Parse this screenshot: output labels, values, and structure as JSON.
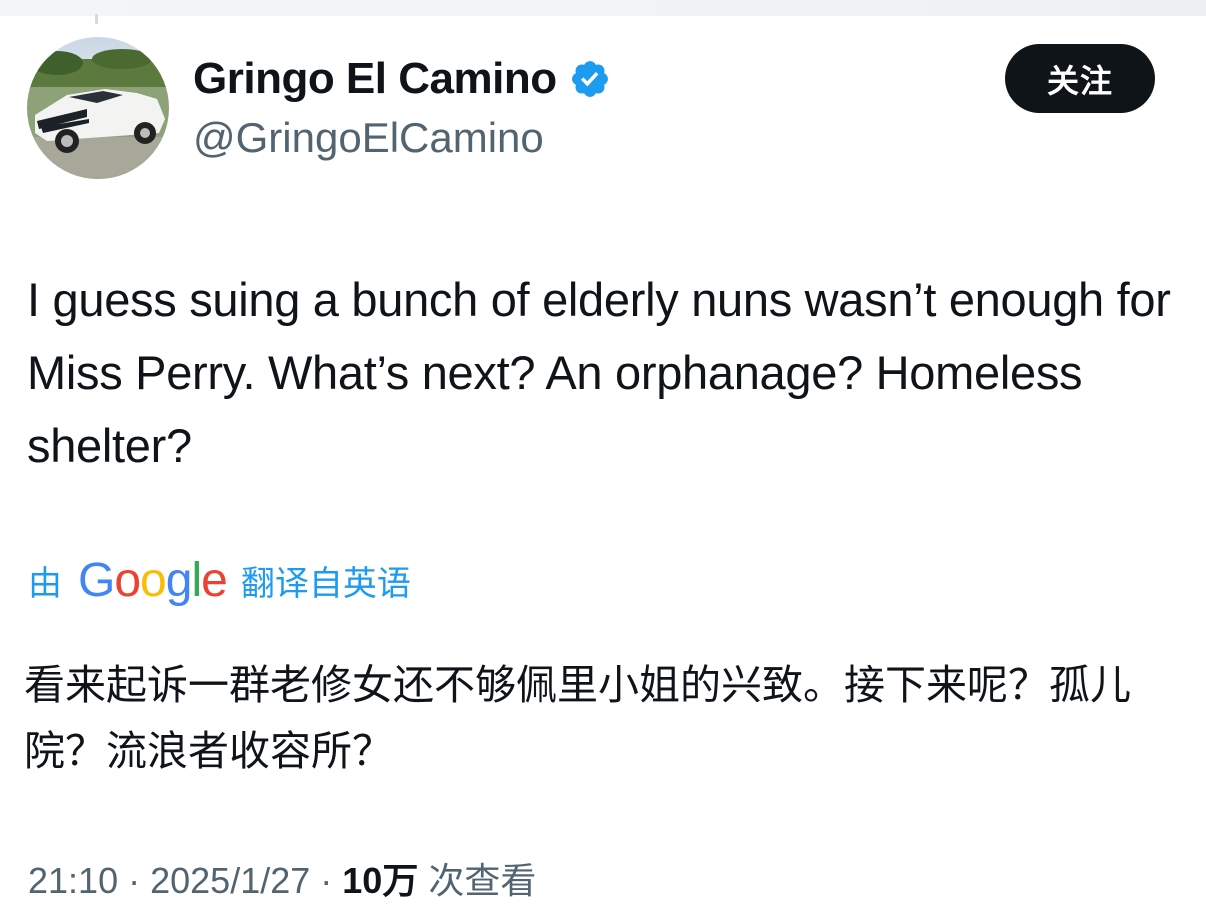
{
  "author": {
    "display_name": "Gringo El Camino",
    "handle": "@GringoElCamino",
    "verified_icon": "verified-badge-icon"
  },
  "follow_button": {
    "label": "关注"
  },
  "tweet": {
    "text": "I guess suing a bunch of elderly nuns wasn’t enough for Miss Perry. What’s next? An orphanage? Homeless shelter?"
  },
  "translation": {
    "by_label": "由",
    "google_logo_text": "Google",
    "from_label": "翻译自英语",
    "text": "看来起诉一群老修女还不够佩里小姐的兴致。接下来呢？孤儿院？流浪者收容所？"
  },
  "meta": {
    "time": "21:10",
    "date": "2025/1/27",
    "views_count": "10万",
    "views_label": "次查看"
  },
  "colors": {
    "text_primary": "#0f1419",
    "text_secondary": "#536471",
    "link_blue": "#1d9bf0",
    "follow_bg": "#0f1419"
  }
}
